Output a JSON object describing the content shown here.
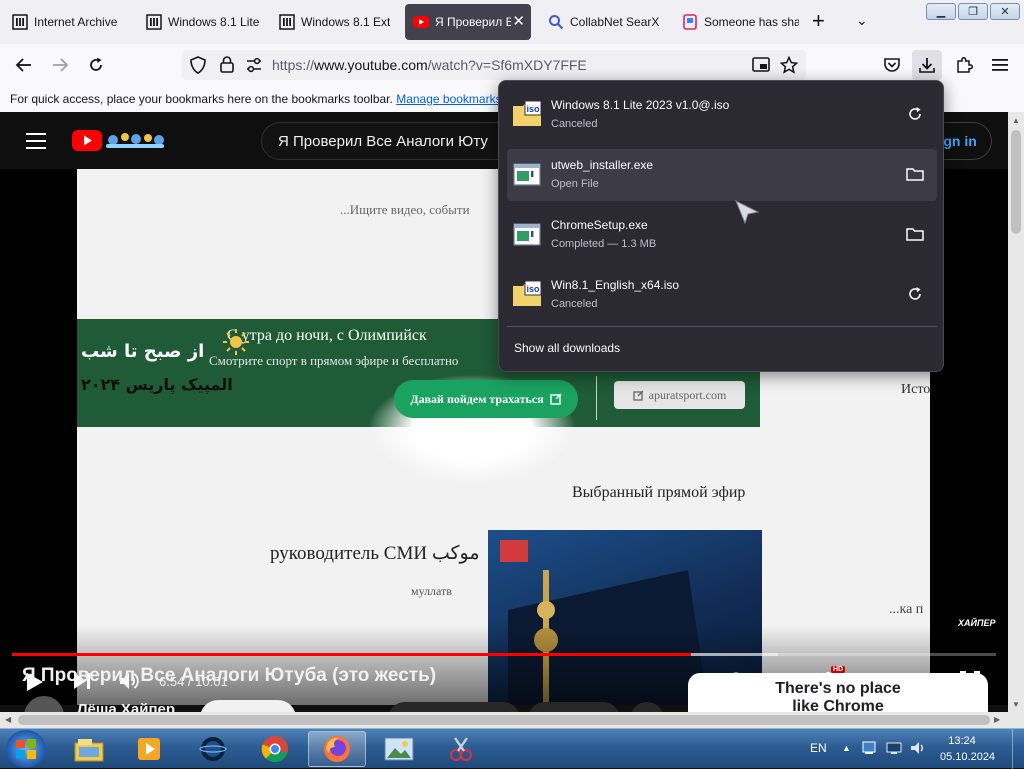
{
  "tabs": [
    {
      "title": "Internet Archive",
      "icon": "archive-icon",
      "active": false
    },
    {
      "title": "Windows 8.1 Lite",
      "icon": "archive-icon",
      "active": false
    },
    {
      "title": "Windows 8.1 Ext",
      "icon": "archive-icon",
      "active": false
    },
    {
      "title": "Я Проверил В",
      "icon": "youtube-icon",
      "active": true
    },
    {
      "title": "CollabNet SearX",
      "icon": "search-icon",
      "active": false
    },
    {
      "title": "Someone has sha",
      "icon": "brand-icon",
      "active": false
    }
  ],
  "nav": {
    "url_prefix": "https://",
    "url_host": "www.youtube.com",
    "url_path": "/watch?v=Sf6mXDY7FFE"
  },
  "bookmarks": {
    "hint": "For quick access, place your bookmarks here on the bookmarks toolbar.",
    "manage_link": "Manage bookmarks…"
  },
  "youtube": {
    "search_value": "Я Проверил Все Аналоги Юту",
    "sign_in": "Sign in",
    "video_title": "Я Проверил Все Аналоги Ютуба (это жесть)",
    "channel_name": "Лёша Хайпер",
    "player": {
      "time_current": "6:54",
      "time_separator": " / ",
      "time_total": "10:01",
      "progress_fraction": 0.69,
      "watermark": "ХАЙПЕР",
      "hd_badge": "HD"
    },
    "frame": {
      "search_hint": "...Ищите видео, событи",
      "banner_text_1": "С утра до ночи, с Олимпийск",
      "banner_text_2": "Смотрите спорт в прямом эфире и бесплатно",
      "banner_persian_1": "از صبح تا شب",
      "banner_persian_2": "المپیک پاریس ۲۰۲۴",
      "banner_button": "Давай пойдем трахаться",
      "banner_site": "apuratsport.com",
      "side_label": "Исто",
      "live_label": "Выбранный прямой эфир",
      "media_head": "руководитель СМИ",
      "media_head_persian": "موکب",
      "media_sub": "муллатв",
      "frame_right_cut": "...ка п"
    },
    "ad": {
      "line1": "There's no place",
      "line2": "like Chrome"
    }
  },
  "downloads": {
    "items": [
      {
        "name": "Windows 8.1 Lite 2023 v1.0@.iso",
        "status": "Canceled",
        "icon": "iso-file-icon",
        "action": "retry-icon"
      },
      {
        "name": "utweb_installer.exe",
        "status": "Open File",
        "icon": "exe-file-icon",
        "action": "folder-icon"
      },
      {
        "name": "ChromeSetup.exe",
        "status": "Completed — 1.3 MB",
        "icon": "exe-file-icon",
        "action": "folder-icon"
      },
      {
        "name": "Win8.1_English_x64.iso",
        "status": "Canceled",
        "icon": "iso-file-icon",
        "action": "retry-icon"
      }
    ],
    "iso_label": "iso",
    "show_all": "Show all downloads"
  },
  "taskbar": {
    "apps": [
      "file-explorer-icon",
      "media-player-icon",
      "space-app-icon",
      "chrome-icon",
      "firefox-icon",
      "image-viewer-icon",
      "snipping-tool-icon"
    ],
    "language": "EN",
    "time": "13:24",
    "date": "05.10.2024"
  },
  "colors": {
    "accent": "#0061e0",
    "youtube_red": "#ff0000",
    "panel_bg": "#2b2a33",
    "banner_green": "#1e5b36",
    "button_green": "#1aa260"
  }
}
